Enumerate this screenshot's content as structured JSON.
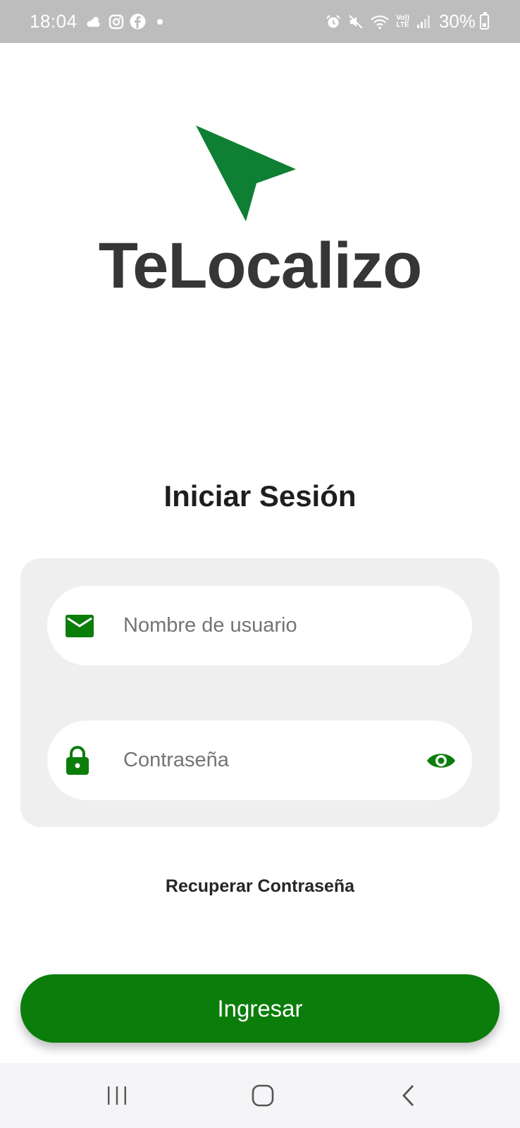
{
  "status_bar": {
    "time": "18:04",
    "left_icons": [
      "weather-icon",
      "instagram-icon",
      "facebook-icon",
      "dot-icon"
    ],
    "right_icons": [
      "alarm-icon",
      "mute-icon",
      "wifi-icon",
      "volte-lte-icon",
      "signal-icon"
    ],
    "volte_label": "Vo))",
    "lte_label": "LTE",
    "battery_percent": "30%"
  },
  "brand": {
    "name": "TeLocalizo",
    "logo_icon": "location-arrow-icon",
    "color": "#0f7f33"
  },
  "login": {
    "title": "Iniciar Sesión",
    "username_placeholder": "Nombre de usuario",
    "username_value": "",
    "username_icon": "email-icon",
    "password_placeholder": "Contraseña",
    "password_value": "",
    "password_icon": "lock-icon",
    "visibility_icon": "eye-icon",
    "recover_label": "Recuperar Contraseña",
    "submit_label": "Ingresar",
    "accent_color": "#0b7d0b"
  },
  "nav_bar": {
    "items": [
      "recent-apps-icon",
      "home-icon",
      "back-icon"
    ]
  }
}
